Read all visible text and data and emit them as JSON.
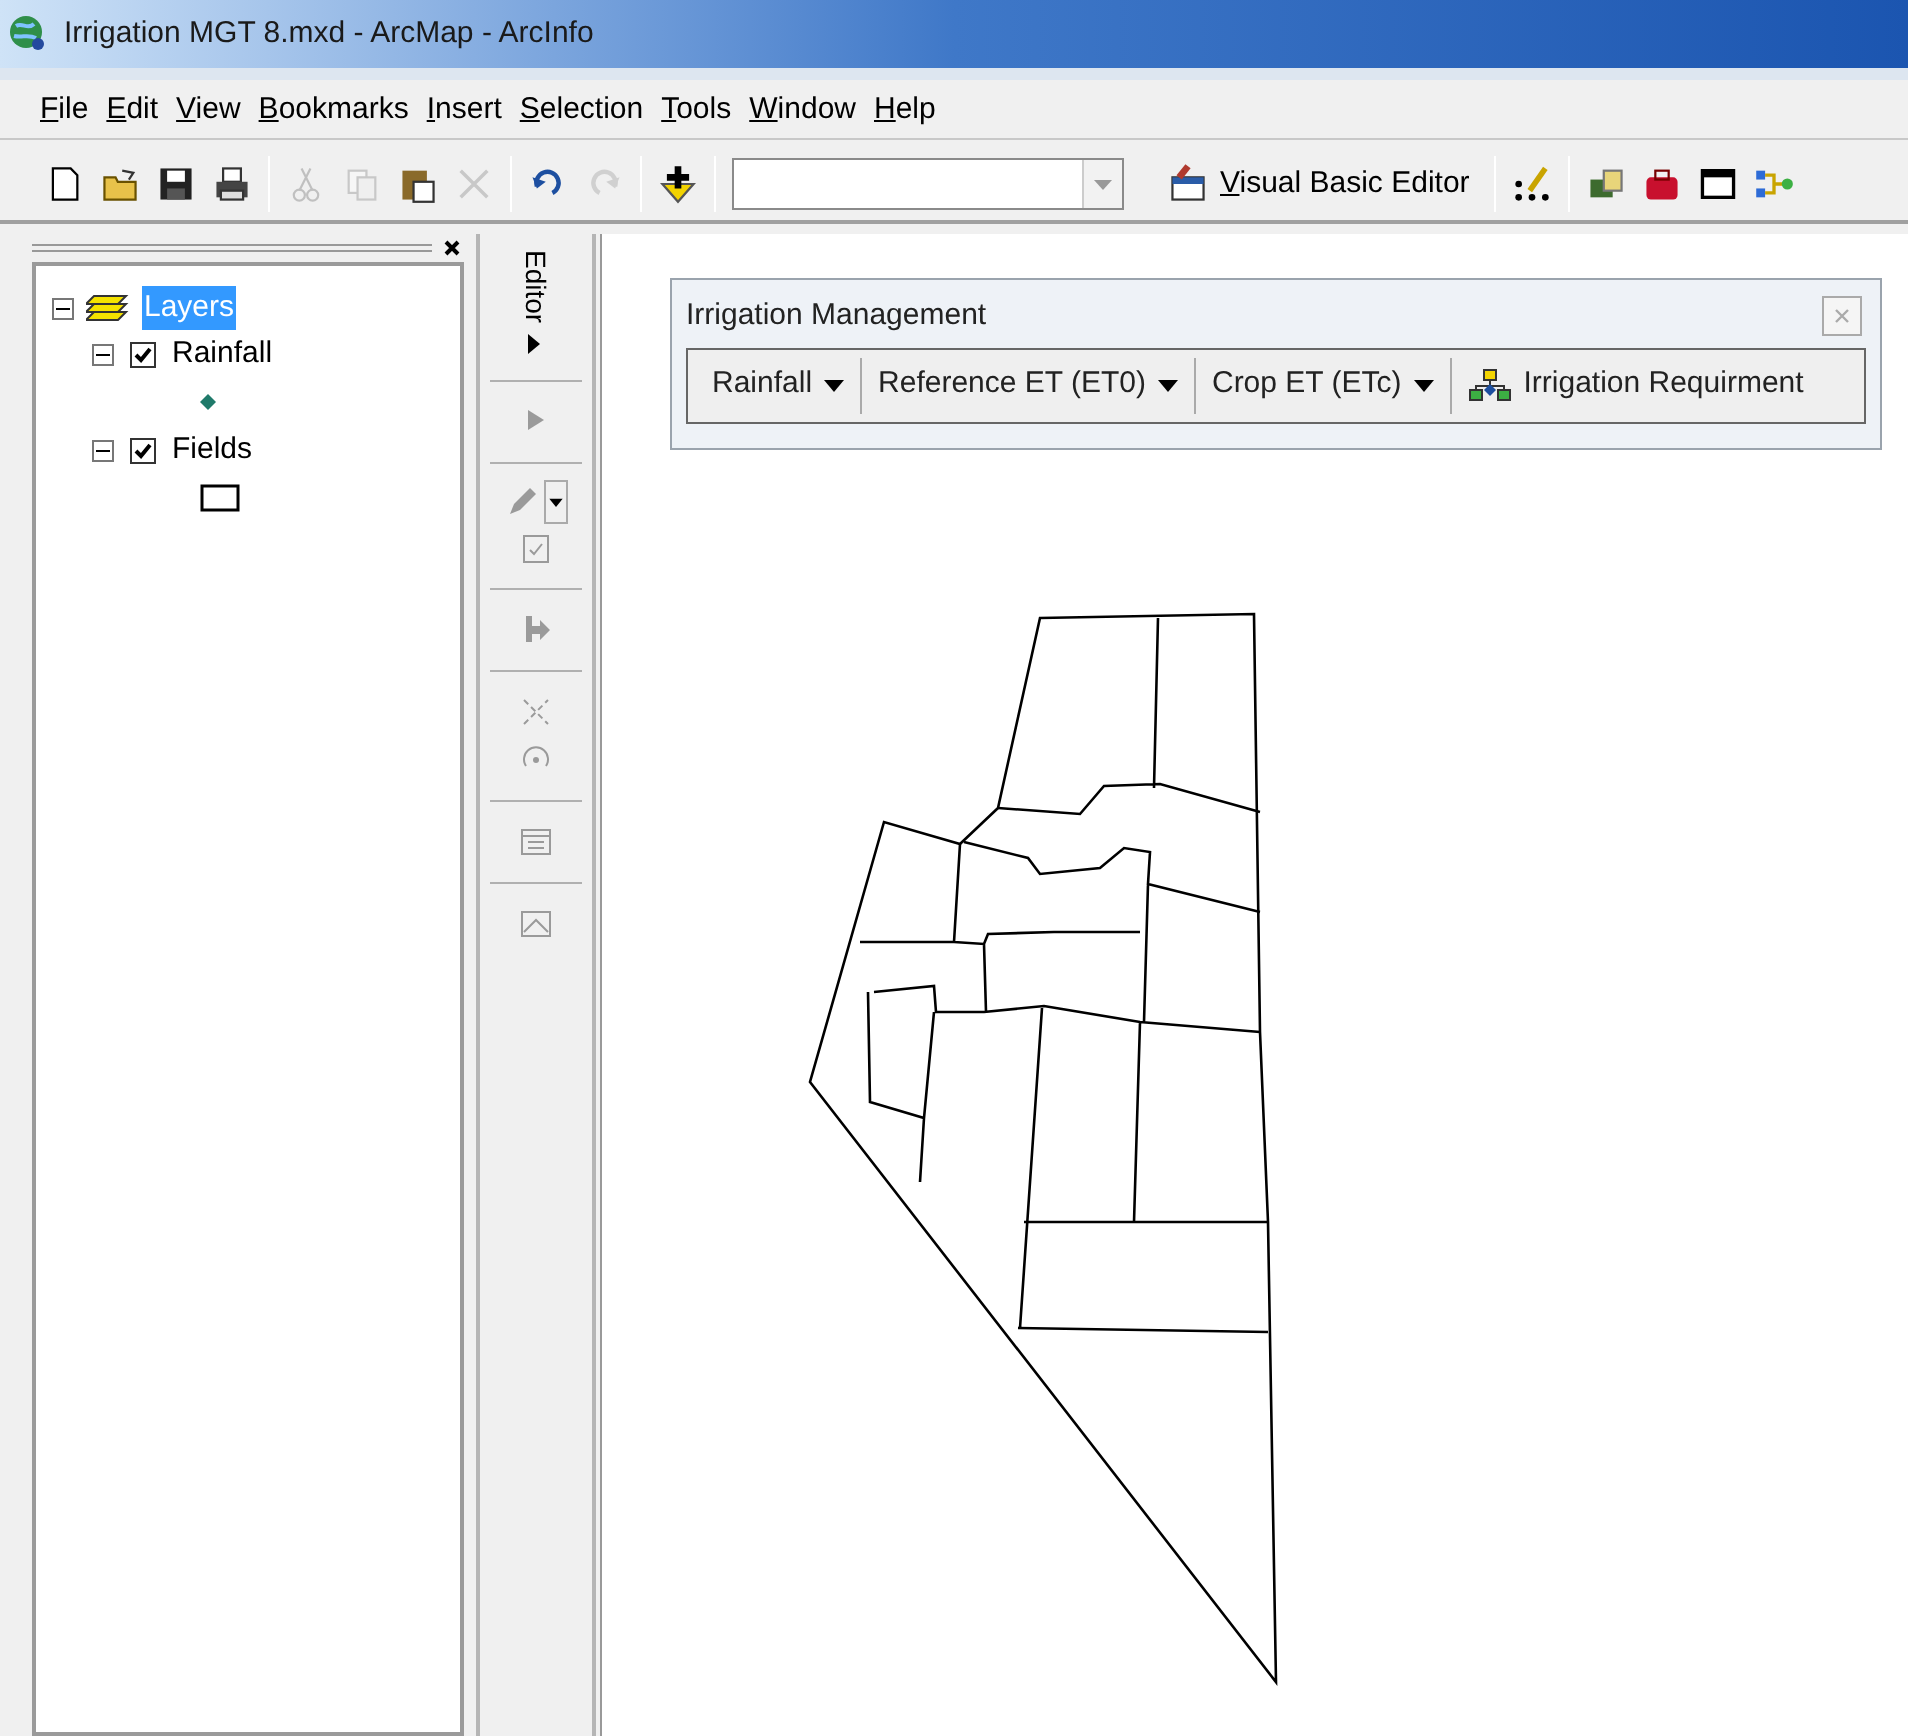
{
  "window": {
    "title": "Irrigation MGT 8.mxd - ArcMap - ArcInfo"
  },
  "menu": [
    "File",
    "Edit",
    "View",
    "Bookmarks",
    "Insert",
    "Selection",
    "Tools",
    "Window",
    "Help"
  ],
  "toolbar": {
    "left": [
      {
        "kind": "new",
        "disabled": false
      },
      {
        "kind": "open",
        "disabled": false
      },
      {
        "kind": "save",
        "disabled": false
      },
      {
        "kind": "print",
        "disabled": false
      },
      {
        "kind": "sep"
      },
      {
        "kind": "cut",
        "disabled": true
      },
      {
        "kind": "copy",
        "disabled": true
      },
      {
        "kind": "paste",
        "disabled": false
      },
      {
        "kind": "delete",
        "disabled": true
      },
      {
        "kind": "sep"
      },
      {
        "kind": "undo",
        "disabled": false
      },
      {
        "kind": "redo",
        "disabled": true
      },
      {
        "kind": "sep"
      },
      {
        "kind": "add",
        "disabled": false
      },
      {
        "kind": "sep"
      }
    ],
    "vba_button": "Visual Basic Editor",
    "right": [
      {
        "kind": "sep"
      },
      {
        "kind": "sketch",
        "disabled": false
      },
      {
        "kind": "sep"
      },
      {
        "kind": "catalog",
        "disabled": false
      },
      {
        "kind": "toolbox",
        "disabled": false
      },
      {
        "kind": "window",
        "disabled": false
      },
      {
        "kind": "model",
        "disabled": false
      }
    ]
  },
  "toc": {
    "label": "Layers",
    "selected": true,
    "expanded": true,
    "children": [
      {
        "label": "Rainfall",
        "checked": true,
        "expanded": true,
        "kind": "point"
      },
      {
        "label": "Fields",
        "checked": true,
        "expanded": true,
        "kind": "polygon"
      }
    ]
  },
  "editor_toolbar": {
    "title": "Editor"
  },
  "irrigation_toolbar": {
    "title": "Irrigation Management",
    "items": [
      {
        "label": "Rainfall",
        "kind": "dropdown"
      },
      {
        "label": "Reference ET (ET0)",
        "kind": "dropdown"
      },
      {
        "label": "Crop ET (ETc)",
        "kind": "dropdown"
      },
      {
        "label": "Irrigation Requirment",
        "kind": "button"
      }
    ]
  }
}
